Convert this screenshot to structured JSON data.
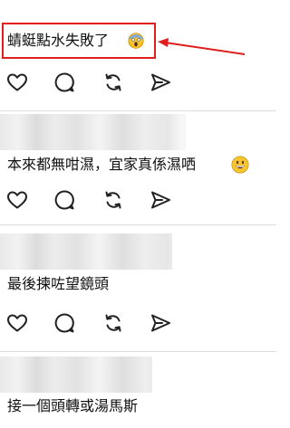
{
  "posts": [
    {
      "comment": "蜻蜓點水失敗了",
      "emoji": "face-screaming-in-fear-icon"
    },
    {
      "comment": "本來都無咁濕，宜家真係濕哂",
      "emoji": "grinning-face-icon"
    },
    {
      "comment": "最後揀咗望鏡頭",
      "emoji": ""
    },
    {
      "comment": "接一個頭轉或湯馬斯",
      "emoji": ""
    }
  ],
  "actions": [
    "heart-icon",
    "comment-icon",
    "repost-icon",
    "share-icon"
  ],
  "colors": {
    "annotation": "#e01e1e",
    "icon": "#222222",
    "divider": "#dddddd",
    "emoji_yellow": "#f7c52f"
  }
}
